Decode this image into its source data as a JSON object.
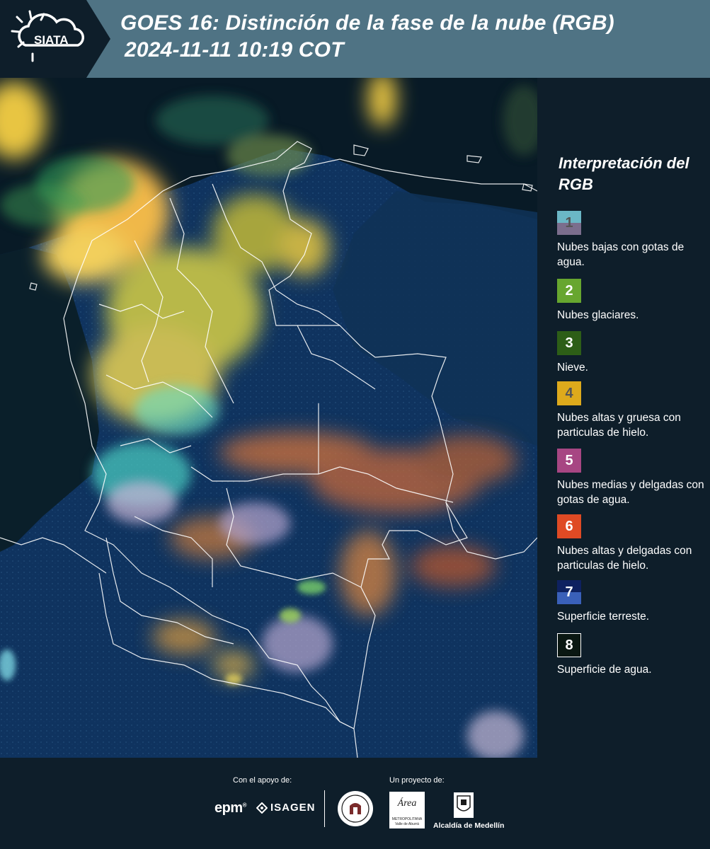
{
  "header": {
    "logo_text": "SIATA",
    "title_line1": "GOES 16: Distinción de la fase de la nube (RGB)",
    "title_line2": "2024-11-11 10:19 COT",
    "background_color": "#4f7384",
    "logo_background_color": "#0e1e2a"
  },
  "map": {
    "description_icon": "satellite-rgb-map",
    "dominant_colors": [
      "#0d2a4f",
      "#e8c542",
      "#d4733a",
      "#6ae0d4",
      "#c9b6d6"
    ]
  },
  "legend": {
    "title": "Interpretación del RGB",
    "items": [
      {
        "number": "1",
        "label": "Nubes bajas con gotas de agua.",
        "color_top": "#6bb7c6",
        "color_bottom": "#7b6e8d",
        "number_color": "#555555"
      },
      {
        "number": "2",
        "label": "Nubes glaciares.",
        "color_top": "#67a62f",
        "color_bottom": "#67a62f",
        "number_color": "#ffffff"
      },
      {
        "number": "3",
        "label": "Nieve.",
        "color_top": "#2d5e17",
        "color_bottom": "#2d5e17",
        "number_color": "#ffffff"
      },
      {
        "number": "4",
        "label": "Nubes altas y gruesa con particulas de hielo.",
        "color_top": "#deaa1c",
        "color_bottom": "#deaa1c",
        "number_color": "#555555"
      },
      {
        "number": "5",
        "label": "Nubes medias y delgadas con gotas de agua.",
        "color_top": "#a74683",
        "color_bottom": "#a74683",
        "number_color": "#ffffff"
      },
      {
        "number": "6",
        "label": "Nubes altas y delgadas con particulas de hielo.",
        "color_top": "#df4a24",
        "color_bottom": "#df4a24",
        "number_color": "#ffffff"
      },
      {
        "number": "7",
        "label": "Superficie terreste.",
        "color_top": "#0e2160",
        "color_bottom": "#3a60b9",
        "number_color": "#ffffff"
      },
      {
        "number": "8",
        "label": "Superficie de agua.",
        "color_top": "#0a1712",
        "color_bottom": "#0a1712",
        "number_color": "#ffffff"
      }
    ]
  },
  "footer": {
    "support_caption": "Con el apoyo de:",
    "project_caption": "Un proyecto de:",
    "epm_text": "epm",
    "isagen_text": "ISAGEN",
    "area_text_1": "Área",
    "area_text_2": "METROPOLITANA",
    "area_text_3": "Valle de Aburrá",
    "alcaldia_text": "Alcaldía de Medellín"
  }
}
